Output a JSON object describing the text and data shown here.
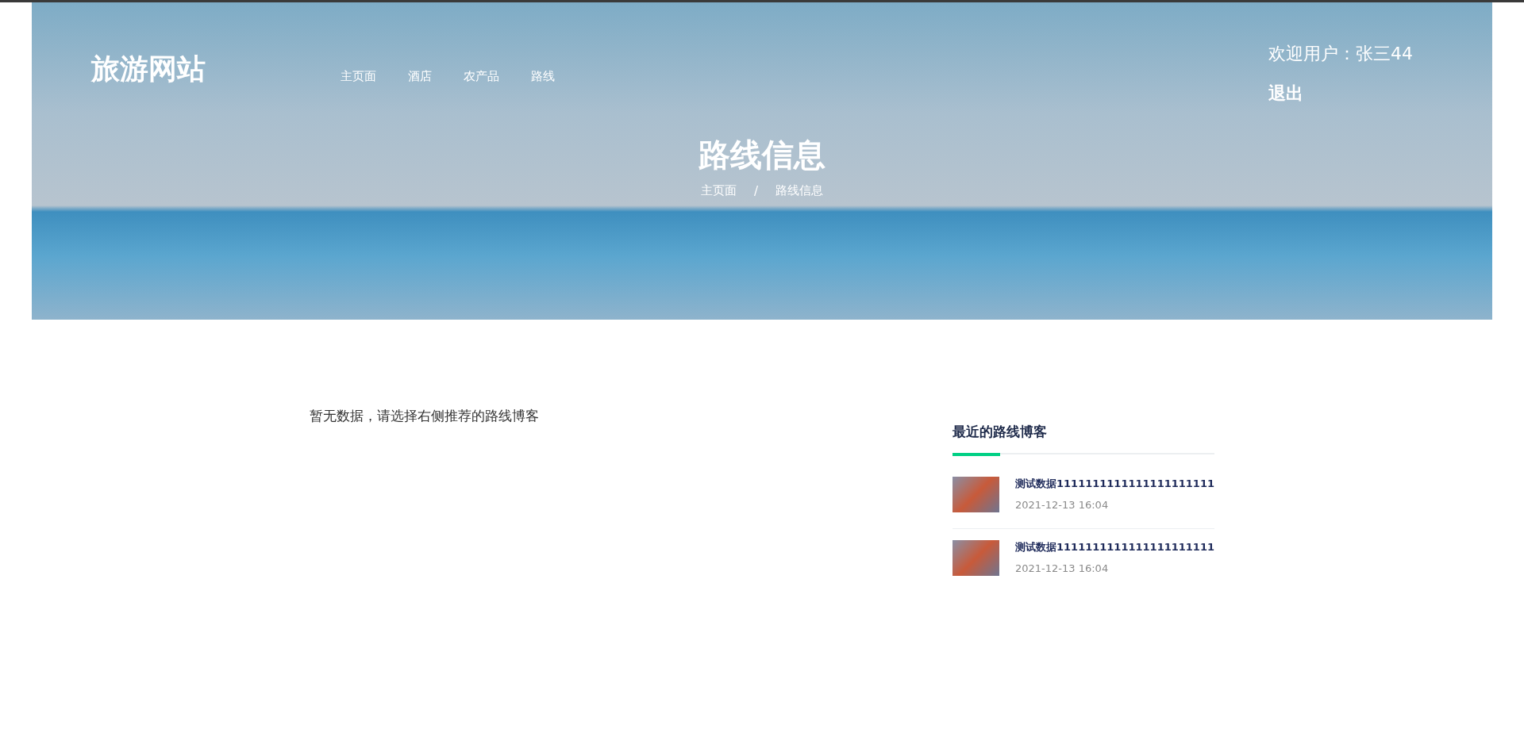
{
  "header": {
    "logo": "旅游网站",
    "nav": [
      {
        "label": "主页面"
      },
      {
        "label": "酒店"
      },
      {
        "label": "农产品"
      },
      {
        "label": "路线"
      }
    ],
    "welcome": "欢迎用户：张三44",
    "logout": "退出"
  },
  "hero": {
    "title": "路线信息",
    "breadcrumb": [
      {
        "label": "主页面"
      },
      {
        "label": "路线信息"
      }
    ],
    "separator": "/"
  },
  "main": {
    "empty_message": "暂无数据，请选择右侧推荐的路线博客"
  },
  "sidebar": {
    "heading": "最近的路线博客",
    "posts": [
      {
        "title": "测试数据1111111111111111111111",
        "date": "2021-12-13 16:04"
      },
      {
        "title": "测试数据1111111111111111111111",
        "date": "2021-12-13 16:04"
      }
    ]
  }
}
